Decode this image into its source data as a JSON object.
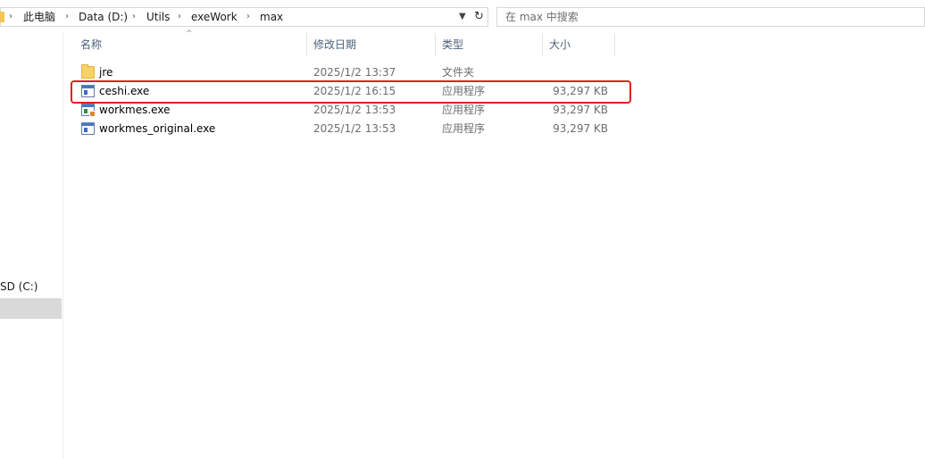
{
  "breadcrumb": {
    "items": [
      "此电脑",
      "Data (D:)",
      "Utils",
      "exeWork",
      "max"
    ],
    "separator": "›",
    "dropdown_icon": "chevron-down-icon"
  },
  "refresh": {
    "icon": "refresh-icon",
    "glyph": "↻"
  },
  "search": {
    "placeholder": "在 max 中搜索"
  },
  "nav": {
    "drive_label": "SD (C:)"
  },
  "columns": {
    "name": "名称",
    "modified": "修改日期",
    "type": "类型",
    "size": "大小",
    "sort_indicator": "^"
  },
  "files": [
    {
      "name": "jre",
      "modified": "2025/1/2 13:37",
      "type": "文件夹",
      "size": "",
      "icon": "folder-icon"
    },
    {
      "name": "ceshi.exe",
      "modified": "2025/1/2 16:15",
      "type": "应用程序",
      "size": "93,297 KB",
      "icon": "exe-icon"
    },
    {
      "name": "workmes.exe",
      "modified": "2025/1/2 13:53",
      "type": "应用程序",
      "size": "93,297 KB",
      "icon": "java-exe-icon"
    },
    {
      "name": "workmes_original.exe",
      "modified": "2025/1/2 13:53",
      "type": "应用程序",
      "size": "93,297 KB",
      "icon": "exe-icon"
    }
  ],
  "highlight": {
    "target": "ceshi.exe",
    "color": "#e41f1f"
  },
  "colors": {
    "header_text": "#4c607a",
    "selected_nav": "#d9d9d9",
    "folder": "#f6d365"
  }
}
